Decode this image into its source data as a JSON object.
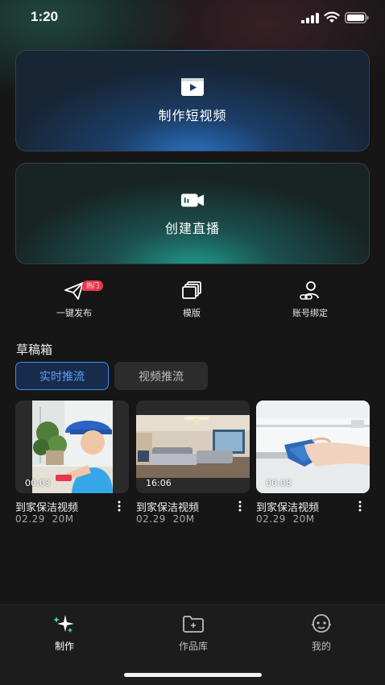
{
  "status_bar": {
    "time": "1:20"
  },
  "actions": {
    "short_video": {
      "label": "制作短视频",
      "icon": "play-icon"
    },
    "live": {
      "label": "创建直播",
      "icon": "camera-icon"
    }
  },
  "quick": [
    {
      "label": "一键发布",
      "badge": "热门",
      "icon": "send-icon"
    },
    {
      "label": "模版",
      "icon": "template-icon"
    },
    {
      "label": "账号绑定",
      "icon": "account-link-icon"
    }
  ],
  "drafts": {
    "title": "草稿箱",
    "tabs": [
      {
        "label": "实时推流",
        "active": true
      },
      {
        "label": "视频推流",
        "active": false
      }
    ],
    "items": [
      {
        "title": "到家保洁视频",
        "duration": "00:03",
        "date": "02.29",
        "size": "20M"
      },
      {
        "title": "到家保洁视频",
        "duration": "16:06",
        "date": "02.29",
        "size": "20M"
      },
      {
        "title": "到家保洁视频",
        "duration": "00:08",
        "date": "02.29",
        "size": "20M"
      }
    ]
  },
  "nav": [
    {
      "label": "制作",
      "icon": "sparkle-star-icon",
      "active": true
    },
    {
      "label": "作品库",
      "icon": "folder-icon",
      "active": false
    },
    {
      "label": "我的",
      "icon": "profile-face-icon",
      "active": false
    }
  ],
  "colors": {
    "accent": "#3e8bf5",
    "badge": "#e8384f",
    "background": "#161616"
  }
}
